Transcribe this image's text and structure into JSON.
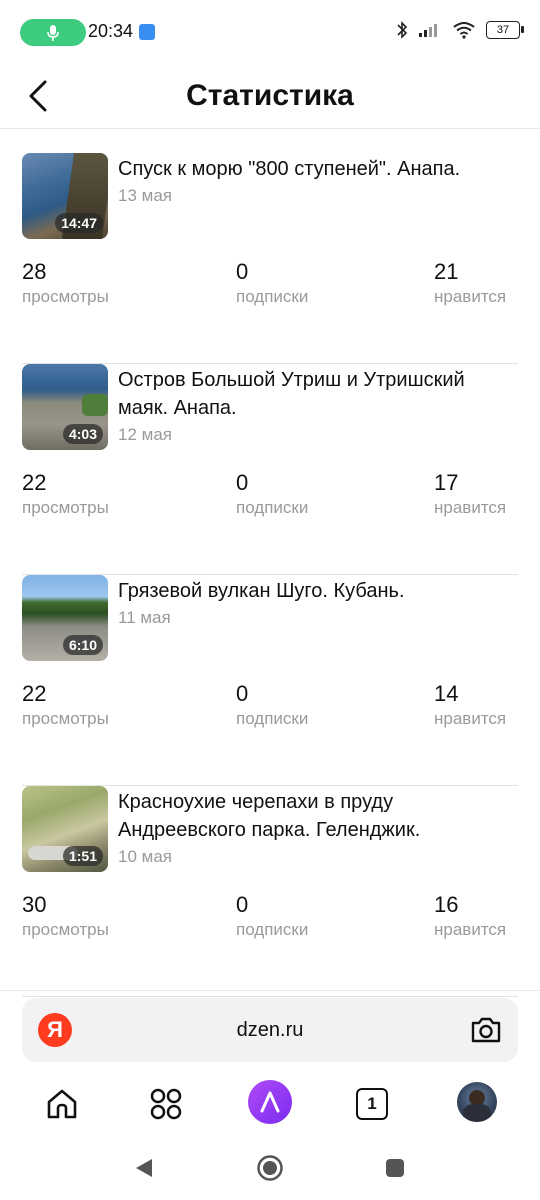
{
  "status_bar": {
    "time": "20:34",
    "battery": "37",
    "accent_mic": "#3ccb7f"
  },
  "header": {
    "title": "Статистика"
  },
  "videos": [
    {
      "title": "Спуск к морю \"800 ступеней\". Анапа.",
      "date": "13 мая",
      "duration": "14:47",
      "views": "28",
      "views_label": "просмотры",
      "subs": "0",
      "subs_label": "подписки",
      "likes": "21",
      "likes_label": "нравится"
    },
    {
      "title": "Остров Большой Утриш и Утришский маяк. Анапа.",
      "date": "12 мая",
      "duration": "4:03",
      "views": "22",
      "views_label": "просмотры",
      "subs": "0",
      "subs_label": "подписки",
      "likes": "17",
      "likes_label": "нравится"
    },
    {
      "title": "Грязевой вулкан Шуго. Кубань.",
      "date": "11 мая",
      "duration": "6:10",
      "views": "22",
      "views_label": "просмотры",
      "subs": "0",
      "subs_label": "подписки",
      "likes": "14",
      "likes_label": "нравится"
    },
    {
      "title": "Красноухие черепахи в пруду Андреевского парка. Геленджик.",
      "date": "10 мая",
      "duration": "1:51",
      "views": "30",
      "views_label": "просмотры",
      "subs": "0",
      "subs_label": "подписки",
      "likes": "16",
      "likes_label": "нравится"
    }
  ],
  "browser": {
    "url": "dzen.ru",
    "yandex_letter": "Я",
    "tabs_count": "1"
  },
  "icons": {
    "back": "chevron-left-icon",
    "home": "home-icon",
    "services": "grid-icon",
    "alice": "alice-icon",
    "tabs": "tabs-icon",
    "camera": "camera-icon"
  }
}
